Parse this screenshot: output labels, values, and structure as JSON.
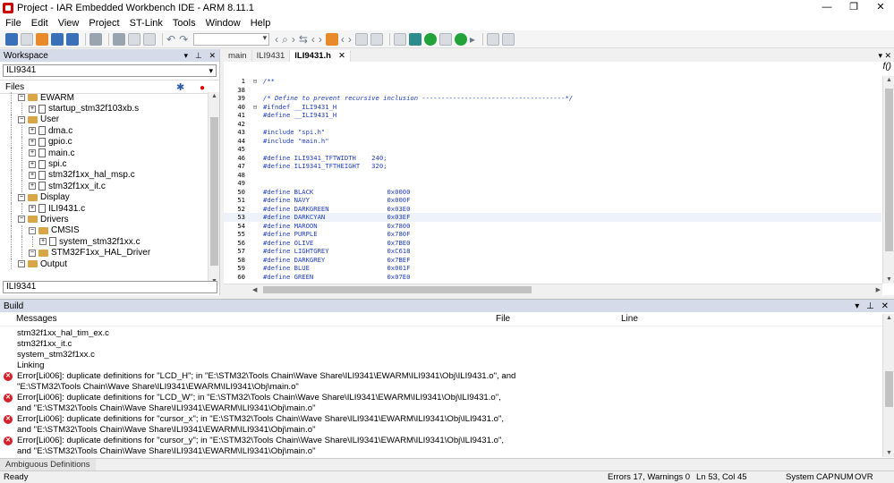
{
  "window": {
    "title": "Project - IAR Embedded Workbench IDE - ARM 8.11.1",
    "controls": [
      "—",
      "❐",
      "✕"
    ]
  },
  "menu": [
    "File",
    "Edit",
    "View",
    "Project",
    "ST-Link",
    "Tools",
    "Window",
    "Help"
  ],
  "workspace": {
    "title": "Workspace",
    "project_selector": "ILI9341",
    "files_label": "Files",
    "bottom_field": "ILI9341",
    "tree": [
      {
        "label": "EWARM",
        "type": "folder",
        "level": 1
      },
      {
        "label": "startup_stm32f103xb.s",
        "type": "file",
        "level": 2
      },
      {
        "label": "User",
        "type": "folder",
        "level": 1
      },
      {
        "label": "dma.c",
        "type": "file",
        "level": 2
      },
      {
        "label": "gpio.c",
        "type": "file",
        "level": 2
      },
      {
        "label": "main.c",
        "type": "file",
        "level": 2
      },
      {
        "label": "spi.c",
        "type": "file",
        "level": 2
      },
      {
        "label": "stm32f1xx_hal_msp.c",
        "type": "file",
        "level": 2
      },
      {
        "label": "stm32f1xx_it.c",
        "type": "file",
        "level": 2
      },
      {
        "label": "Display",
        "type": "folder",
        "level": 1
      },
      {
        "label": "ILI9431.c",
        "type": "file",
        "level": 2
      },
      {
        "label": "Drivers",
        "type": "folder",
        "level": 1
      },
      {
        "label": "CMSIS",
        "type": "folder",
        "level": 2
      },
      {
        "label": "system_stm32f1xx.c",
        "type": "file",
        "level": 3
      },
      {
        "label": "STM32F1xx_HAL_Driver",
        "type": "folder",
        "level": 2
      },
      {
        "label": "Output",
        "type": "folder",
        "level": 1
      }
    ]
  },
  "editor": {
    "tabs": [
      {
        "label": "main",
        "active": false
      },
      {
        "label": "ILI9431",
        "active": false
      },
      {
        "label": "ILI9431.h",
        "active": true,
        "close": "✕"
      }
    ],
    "fx_label": "f()",
    "lines": [
      {
        "n": "1",
        "fold": "⊟",
        "t": "/**",
        "cls": "cm"
      },
      {
        "n": "38",
        "fold": "",
        "t": "",
        "cls": ""
      },
      {
        "n": "39",
        "fold": "",
        "t": "/* Define to prevent recursive inclusion -------------------------------------*/",
        "cls": "cm"
      },
      {
        "n": "40",
        "fold": "⊟",
        "t": "#ifndef __ILI9431_H",
        "cls": "kw"
      },
      {
        "n": "41",
        "fold": "",
        "t": "#define __ILI9431_H",
        "cls": "kw"
      },
      {
        "n": "42",
        "fold": "",
        "t": "",
        "cls": ""
      },
      {
        "n": "43",
        "fold": "",
        "t": "#include \"spi.h\"",
        "cls": "kw"
      },
      {
        "n": "44",
        "fold": "",
        "t": "#include \"main.h\"",
        "cls": "kw"
      },
      {
        "n": "45",
        "fold": "",
        "t": "",
        "cls": ""
      },
      {
        "n": "46",
        "fold": "",
        "t": "#define ILI9341_TFTWIDTH    240;",
        "cls": "kw"
      },
      {
        "n": "47",
        "fold": "",
        "t": "#define ILI9341_TFTHEIGHT   320;",
        "cls": "kw"
      },
      {
        "n": "48",
        "fold": "",
        "t": "",
        "cls": ""
      },
      {
        "n": "49",
        "fold": "",
        "t": "",
        "cls": ""
      },
      {
        "n": "50",
        "fold": "",
        "t": "#define BLACK                   0x0000",
        "cls": "kw"
      },
      {
        "n": "51",
        "fold": "",
        "t": "#define NAVY                    0x000F",
        "cls": "kw"
      },
      {
        "n": "52",
        "fold": "",
        "t": "#define DARKGREEN               0x03E0",
        "cls": "kw"
      },
      {
        "n": "53",
        "fold": "",
        "t": "#define DARKCYAN                0x03EF",
        "cls": "kw",
        "current": true
      },
      {
        "n": "54",
        "fold": "",
        "t": "#define MAROON                  0x7800",
        "cls": "kw"
      },
      {
        "n": "55",
        "fold": "",
        "t": "#define PURPLE                  0x780F",
        "cls": "kw"
      },
      {
        "n": "56",
        "fold": "",
        "t": "#define OLIVE                   0x7BE0",
        "cls": "kw"
      },
      {
        "n": "57",
        "fold": "",
        "t": "#define LIGHTGREY               0xC618",
        "cls": "kw"
      },
      {
        "n": "58",
        "fold": "",
        "t": "#define DARKGREY                0x7BEF",
        "cls": "kw"
      },
      {
        "n": "59",
        "fold": "",
        "t": "#define BLUE                    0x001F",
        "cls": "kw"
      },
      {
        "n": "60",
        "fold": "",
        "t": "#define GREEN                   0x07E0",
        "cls": "kw"
      }
    ]
  },
  "build": {
    "title": "Build",
    "columns": [
      "Messages",
      "File",
      "Line"
    ],
    "messages": [
      {
        "t": "stm32f1xx_hal_tim_ex.c",
        "err": false
      },
      {
        "t": "stm32f1xx_it.c",
        "err": false
      },
      {
        "t": "system_stm32f1xx.c",
        "err": false
      },
      {
        "t": "Linking",
        "err": false
      },
      {
        "t": "Error[Li006]: duplicate definitions for \"LCD_H\"; in \"E:\\STM32\\Tools Chain\\Wave Share\\ILI9341\\EWARM\\ILI9341\\Obj\\ILI9431.o\", and",
        "err": true
      },
      {
        "t": "\"E:\\STM32\\Tools Chain\\Wave Share\\ILI9341\\EWARM\\ILI9341\\Obj\\main.o\"",
        "err": false
      },
      {
        "t": "Error[Li006]: duplicate definitions for \"LCD_W\"; in \"E:\\STM32\\Tools Chain\\Wave Share\\ILI9341\\EWARM\\ILI9341\\Obj\\ILI9431.o\",",
        "err": true
      },
      {
        "t": "and \"E:\\STM32\\Tools Chain\\Wave Share\\ILI9341\\EWARM\\ILI9341\\Obj\\main.o\"",
        "err": false
      },
      {
        "t": "Error[Li006]: duplicate definitions for \"cursor_x\"; in \"E:\\STM32\\Tools Chain\\Wave Share\\ILI9341\\EWARM\\ILI9341\\Obj\\ILI9431.o\",",
        "err": true
      },
      {
        "t": "and \"E:\\STM32\\Tools Chain\\Wave Share\\ILI9341\\EWARM\\ILI9341\\Obj\\main.o\"",
        "err": false
      },
      {
        "t": "Error[Li006]: duplicate definitions for \"cursor_y\"; in \"E:\\STM32\\Tools Chain\\Wave Share\\ILI9341\\EWARM\\ILI9341\\Obj\\ILI9431.o\",",
        "err": true
      },
      {
        "t": "and \"E:\\STM32\\Tools Chain\\Wave Share\\ILI9341\\EWARM\\ILI9341\\Obj\\main.o\"",
        "err": false
      }
    ]
  },
  "bottom_tabs": [
    "Ambiguous Definitions"
  ],
  "status": {
    "left": "Ready",
    "errors": "Errors 17, Warnings 0",
    "position": "Ln 53, Col 45",
    "encoding": "System",
    "caps": "CAP",
    "num": "NUM",
    "ovr": "OVR"
  }
}
